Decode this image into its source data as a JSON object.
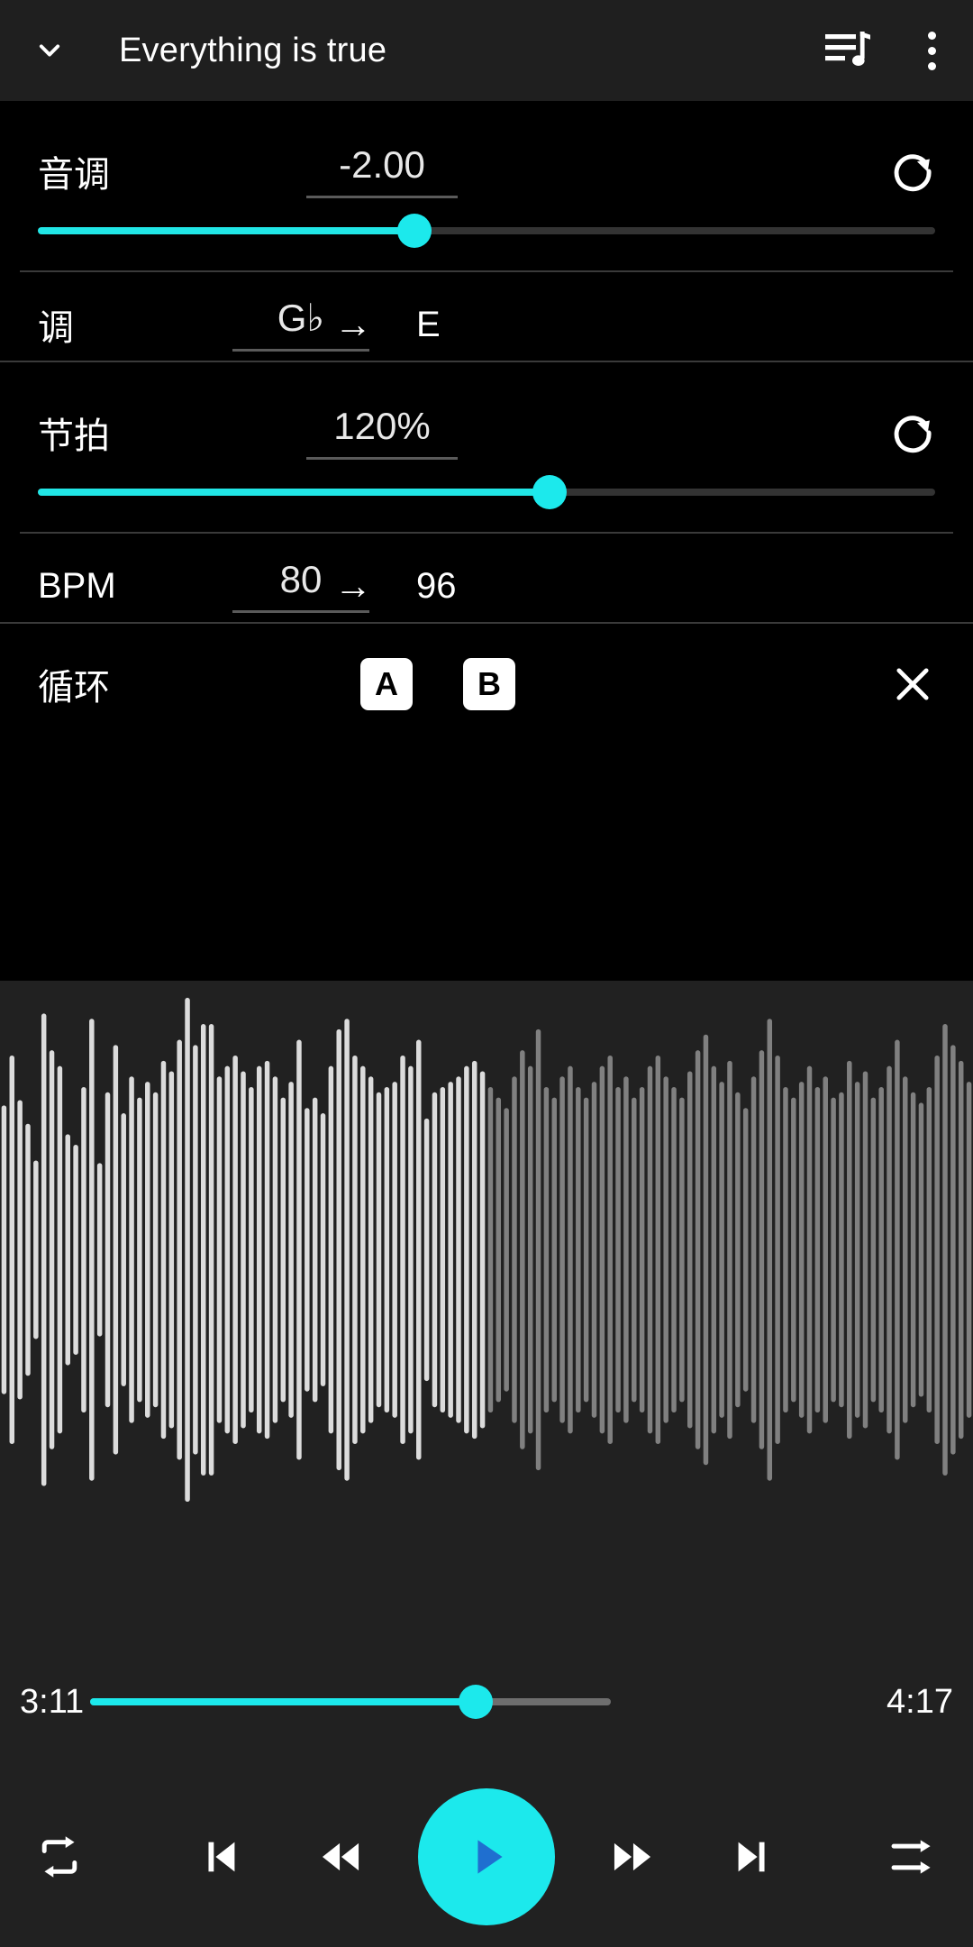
{
  "header": {
    "collapse_icon": "chevron-down-icon",
    "title": "Everything is true",
    "queue_icon": "playlist-music-icon",
    "overflow_icon": "more-vertical-icon"
  },
  "pitch": {
    "label": "音调",
    "value": "-2.00",
    "reset_icon": "refresh-icon",
    "slider_percent": 42
  },
  "key": {
    "label": "调",
    "from": "G♭",
    "arrow": "→",
    "to": "E"
  },
  "tempo": {
    "label": "节拍",
    "value": "120%",
    "reset_icon": "refresh-icon",
    "slider_percent": 57
  },
  "bpm": {
    "label": "BPM",
    "from": "80",
    "arrow": "→",
    "to": "96"
  },
  "loop": {
    "label": "循环",
    "a_label": "A",
    "b_label": "B",
    "close_icon": "close-icon"
  },
  "waveform": {
    "played_color": "#dcdcdc",
    "remaining_color": "#808080",
    "background": "#212121",
    "playhead_percent": 50,
    "bars": [
      55,
      74,
      57,
      48,
      34,
      90,
      76,
      70,
      44,
      40,
      62,
      88,
      33,
      60,
      78,
      52,
      66,
      58,
      64,
      60,
      72,
      68,
      80,
      96,
      78,
      86,
      86,
      66,
      70,
      74,
      68,
      62,
      70,
      72,
      66,
      58,
      64,
      80,
      54,
      58,
      52,
      70,
      84,
      88,
      74,
      70,
      66,
      60,
      62,
      64,
      74,
      70,
      80,
      50,
      60,
      62,
      64,
      66,
      70,
      72,
      68,
      62,
      58,
      54,
      66,
      76,
      70,
      84,
      62,
      58,
      66,
      70,
      62,
      58,
      64,
      70,
      74,
      62,
      66,
      58,
      62,
      70,
      74,
      66,
      62,
      58,
      68,
      76,
      82,
      70,
      64,
      72,
      60,
      54,
      66,
      76,
      88,
      74,
      62,
      58,
      64,
      70,
      62,
      66,
      58,
      60,
      72,
      64,
      68,
      58,
      62,
      70,
      80,
      66,
      60,
      56,
      62,
      74,
      86,
      78,
      72,
      64
    ]
  },
  "seek": {
    "current_time": "3:11",
    "total_time": "4:17",
    "progress_percent": 74,
    "fill_color": "#1ce9ec"
  },
  "transport": {
    "repeat_icon": "repeat-icon",
    "previous_icon": "skip-previous-icon",
    "rewind_icon": "fast-rewind-icon",
    "play_icon": "play-icon",
    "forward_icon": "fast-forward-icon",
    "next_icon": "skip-next-icon",
    "shuffle_icon": "shuffle-icon",
    "play_button_color": "#1ce9ec",
    "play_glyph_color": "#1f6fd0"
  }
}
